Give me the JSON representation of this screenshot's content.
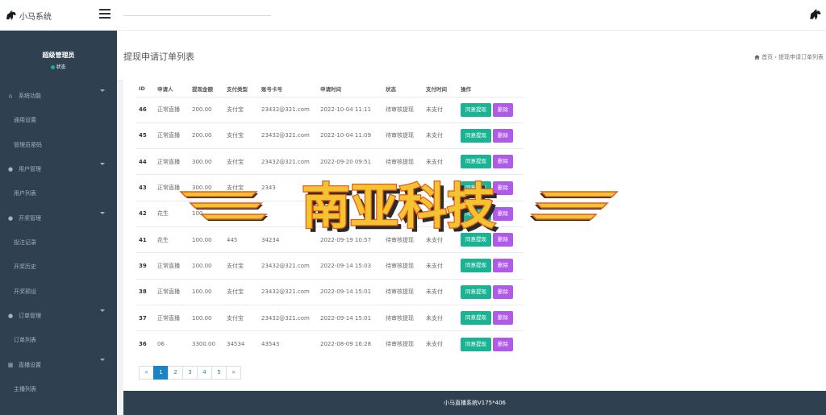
{
  "app": {
    "title": "小马系统"
  },
  "sidebar": {
    "profile_name": "超级管理员",
    "profile_status": "状态",
    "groups": [
      {
        "label": "系统功能",
        "icon": "home-icon",
        "items": [
          "通用设置",
          "管理员密码"
        ]
      },
      {
        "label": "用户管理",
        "icon": "user-icon",
        "items": [
          "用户列表"
        ]
      },
      {
        "label": "开奖管理",
        "icon": "gift-icon",
        "items": [
          "投注记录",
          "开奖历史",
          "开奖预设"
        ]
      },
      {
        "label": "订单管理",
        "icon": "order-icon",
        "items": [
          "订单列表"
        ]
      },
      {
        "label": "直播设置",
        "icon": "grid-icon",
        "items": [
          "主播列表"
        ]
      }
    ]
  },
  "header": {
    "page_title": "提现申请订单列表",
    "breadcrumb_home": "首页",
    "breadcrumb_sep": "›",
    "breadcrumb_current": "提现申请订单列表"
  },
  "table": {
    "columns": [
      "ID",
      "申请人",
      "提现金额",
      "支付类型",
      "账号卡号",
      "申请时间",
      "状态",
      "支付时间",
      "操作"
    ],
    "approve_label": "同意提现",
    "delete_label": "删除",
    "rows": [
      {
        "id": "46",
        "applicant": "正常直播",
        "amount": "200.00",
        "pay_type": "支付宝",
        "account": "23432@321.com",
        "time": "2022-10-04 11:11",
        "status": "待审核提现",
        "pay_time": "未支付"
      },
      {
        "id": "45",
        "applicant": "正常直播",
        "amount": "200.00",
        "pay_type": "支付宝",
        "account": "23432@321.com",
        "time": "2022-10-04 11:09",
        "status": "待审核提现",
        "pay_time": "未支付"
      },
      {
        "id": "44",
        "applicant": "正常直播",
        "amount": "300.00",
        "pay_type": "支付宝",
        "account": "23432@321.com",
        "time": "2022-09-20 09:51",
        "status": "待审核提现",
        "pay_time": "未支付"
      },
      {
        "id": "43",
        "applicant": "正常直播",
        "amount": "300.00",
        "pay_type": "支付宝",
        "account": "2343",
        "time": "",
        "status": "",
        "pay_time": ""
      },
      {
        "id": "42",
        "applicant": "花生",
        "amount": "100",
        "pay_type": "",
        "account": "",
        "time": "",
        "status": "",
        "pay_time": ""
      },
      {
        "id": "41",
        "applicant": "花生",
        "amount": "100.00",
        "pay_type": "445",
        "account": "34234",
        "time": "2022-09-19 10:57",
        "status": "待审核提现",
        "pay_time": "未支付"
      },
      {
        "id": "39",
        "applicant": "正常直播",
        "amount": "100.00",
        "pay_type": "支付宝",
        "account": "23432@321.com",
        "time": "2022-09-14 15:03",
        "status": "待审核提现",
        "pay_time": "未支付"
      },
      {
        "id": "38",
        "applicant": "正常直播",
        "amount": "100.00",
        "pay_type": "支付宝",
        "account": "23432@321.com",
        "time": "2022-09-14 15:01",
        "status": "待审核提现",
        "pay_time": "未支付"
      },
      {
        "id": "37",
        "applicant": "正常直播",
        "amount": "100.00",
        "pay_type": "支付宝",
        "account": "23432@321.com",
        "time": "2022-09-14 15:01",
        "status": "待审核提现",
        "pay_time": "未支付"
      },
      {
        "id": "36",
        "applicant": "06",
        "amount": "3300.00",
        "pay_type": "34534",
        "account": "43543",
        "time": "2022-08-09 16:28",
        "status": "待审核提现",
        "pay_time": "未支付"
      }
    ]
  },
  "pagination": {
    "prev": "«",
    "pages": [
      "1",
      "2",
      "3",
      "4",
      "5"
    ],
    "next": "»",
    "current": "1"
  },
  "footer": {
    "text": "小马直播系统V175*406"
  },
  "watermark": {
    "text": "南亚科技",
    "colors": {
      "fill": "#f4c430",
      "outline": "#e25a1c",
      "shadow": "#2a2a2a"
    }
  },
  "colors": {
    "sidebar": "#2f4050",
    "approve": "#1ab394",
    "delete": "#b05be8",
    "active_page": "#1c84c6"
  }
}
